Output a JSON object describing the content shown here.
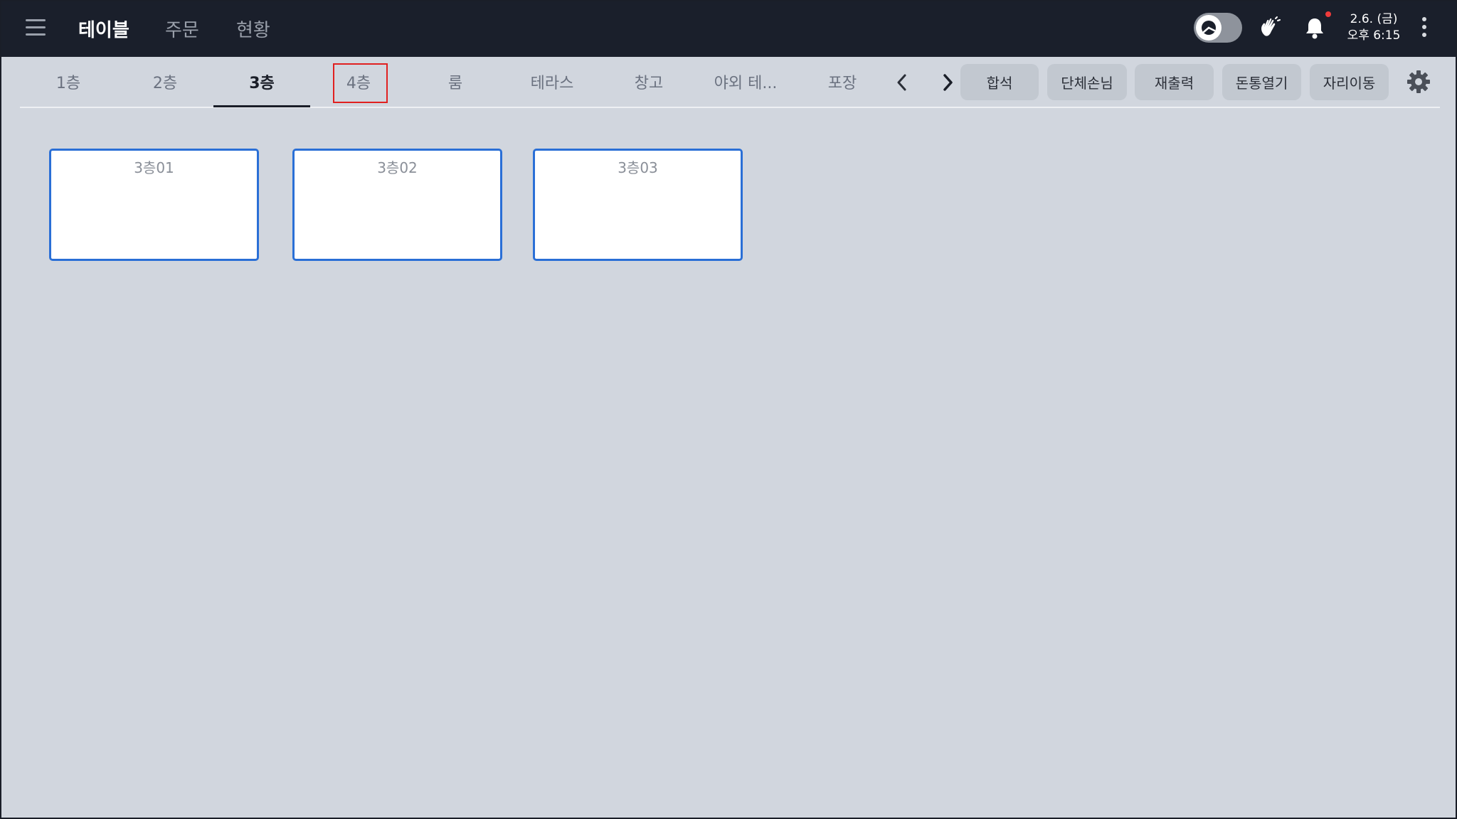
{
  "header": {
    "nav": [
      {
        "label": "테이블",
        "active": true
      },
      {
        "label": "주문",
        "active": false
      },
      {
        "label": "현황",
        "active": false
      }
    ],
    "date": "2.6. (금)",
    "time": "오후 6:15",
    "icons": [
      "menu-icon",
      "clock-toggle",
      "hand-icon",
      "bell-icon",
      "kebab-icon"
    ]
  },
  "floor_tabs": [
    {
      "label": "1층",
      "active": false
    },
    {
      "label": "2층",
      "active": false
    },
    {
      "label": "3층",
      "active": true
    },
    {
      "label": "4층",
      "active": false
    },
    {
      "label": "룸",
      "active": false
    },
    {
      "label": "테라스",
      "active": false
    },
    {
      "label": "창고",
      "active": false
    },
    {
      "label": "야외 테...",
      "active": false
    },
    {
      "label": "포장",
      "active": false
    }
  ],
  "actions": {
    "merge": "합석",
    "group": "단체손님",
    "reprint": "재출력",
    "open_drawer": "돈통열기",
    "move_seat": "자리이동"
  },
  "tables": [
    {
      "name": "3층01"
    },
    {
      "name": "3층02"
    },
    {
      "name": "3층03"
    }
  ],
  "colors": {
    "header_bg": "#1a1f2b",
    "page_bg": "#d1d6de",
    "table_border": "#2a6fd6",
    "highlight": "#e02020",
    "notification_dot": "#ef3b3b"
  }
}
